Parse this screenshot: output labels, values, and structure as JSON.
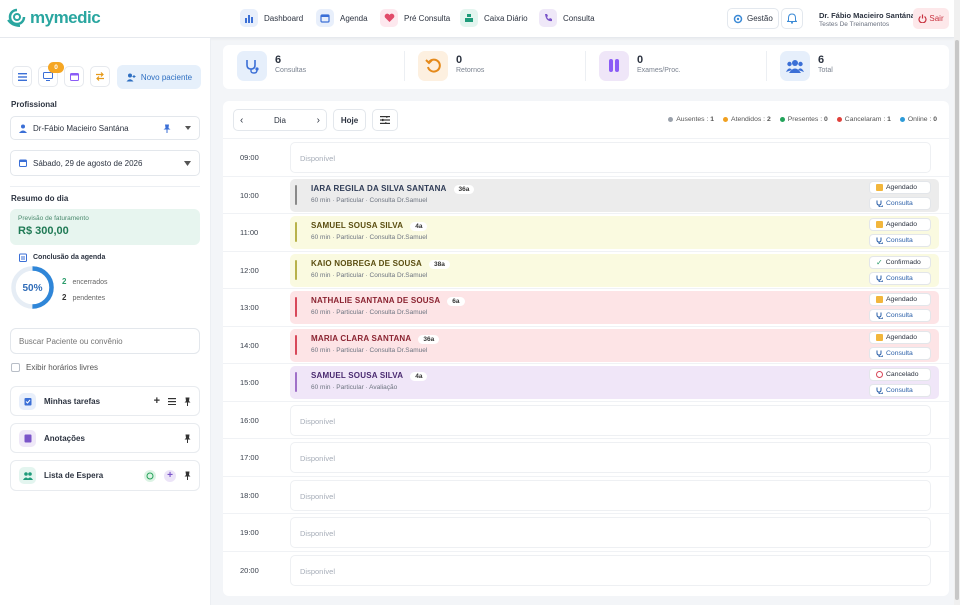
{
  "app": {
    "logo_text": "mymedic"
  },
  "nav": [
    {
      "label": "Dashboard",
      "icon": "bar-chart-icon",
      "color": "#3b6fd6"
    },
    {
      "label": "Agenda",
      "icon": "calendar-icon",
      "color": "#3b6fd6"
    },
    {
      "label": "Pré Consulta",
      "icon": "heart-pulse-icon",
      "color": "#e14b6a"
    },
    {
      "label": "Caixa Diário",
      "icon": "cash-register-icon",
      "color": "#1f9b7a"
    },
    {
      "label": "Consulta",
      "icon": "phone-icon",
      "color": "#7b55c9"
    }
  ],
  "header": {
    "gestao": "Gestão",
    "user_name": "Dr. Fábio Macieiro Santána",
    "user_sub": "Testes De Treinamentos",
    "logout": "Sair"
  },
  "sidebar": {
    "badge": "0",
    "novo_paciente": "Novo paciente",
    "profissional_label": "Profissional",
    "profissional": "Dr-Fábio Macieiro Santána",
    "date": "Sábado, 29 de agosto de 2026",
    "resumo_label": "Resumo do dia",
    "previsao_label": "Previsão de faturamento",
    "previsao_value": "R$ 300,00",
    "conclusao_label": "Conclusão da agenda",
    "conclusao_percent": "50%",
    "conclusao_fraction": 0.5,
    "encerrados_n": "2",
    "encerrados_l": "encerrados",
    "pendentes_n": "2",
    "pendentes_l": "pendentes",
    "search_placeholder": "Buscar Paciente ou convênio",
    "exibir_label": "Exibir horários livres",
    "tarefas": "Minhas tarefas",
    "anotacoes": "Anotações",
    "espera": "Lista de Espera"
  },
  "stats": [
    {
      "value": "6",
      "label": "Consultas",
      "icon": "stethoscope-icon"
    },
    {
      "value": "0",
      "label": "Retornos",
      "icon": "return-icon"
    },
    {
      "value": "0",
      "label": "Exames/Proc.",
      "icon": "test-tubes-icon"
    },
    {
      "value": "6",
      "label": "Total",
      "icon": "users-icon"
    }
  ],
  "schedule": {
    "view": "Dia",
    "today": "Hoje",
    "legend": [
      {
        "label": "Ausentes",
        "count": "1",
        "color": "#9aa1ab"
      },
      {
        "label": "Atendidos",
        "count": "2",
        "color": "#f0a020"
      },
      {
        "label": "Presentes",
        "count": "0",
        "color": "#22a35a"
      },
      {
        "label": "Cancelaram",
        "count": "1",
        "color": "#e0413b"
      },
      {
        "label": "Online",
        "count": "0",
        "color": "#2d9bd8"
      }
    ],
    "slots": [
      {
        "time": "09:00",
        "free": "Disponível"
      },
      {
        "time": "10:00",
        "name": "IARA REGILA DA SILVA SANTANA",
        "age": "36a",
        "detail": "60 min · Particular · Consulta Dr.Samuel",
        "status": "Agendado",
        "action": "Consulta",
        "bg": "#ececec",
        "bar": "#8a8a8a",
        "namecolor": "#2d3a55"
      },
      {
        "time": "11:00",
        "name": "SAMUEL SOUSA SILVA",
        "age": "4a",
        "detail": "60 min · Particular · Consulta Dr.Samuel",
        "status": "Agendado",
        "action": "Consulta",
        "bg": "#fafae0",
        "bar": "#b8b24a",
        "namecolor": "#5a4d10"
      },
      {
        "time": "12:00",
        "name": "KAIO NOBREGA DE SOUSA",
        "age": "38a",
        "detail": "60 min · Particular · Consulta Dr.Samuel",
        "status": "Confirmado",
        "action": "Consulta",
        "bg": "#fafae0",
        "bar": "#b8b24a",
        "namecolor": "#5a4d10"
      },
      {
        "time": "13:00",
        "name": "NATHALIE SANTANA DE SOUSA",
        "age": "6a",
        "detail": "60 min · Particular · Consulta Dr.Samuel",
        "status": "Agendado",
        "action": "Consulta",
        "bg": "#fde4e6",
        "bar": "#d8485a",
        "namecolor": "#8a2230"
      },
      {
        "time": "14:00",
        "name": "MARIA CLARA SANTANA",
        "age": "36a",
        "detail": "60 min · Particular · Consulta Dr.Samuel",
        "status": "Agendado",
        "action": "Consulta",
        "bg": "#fde4e6",
        "bar": "#d8485a",
        "namecolor": "#8a2230"
      },
      {
        "time": "15:00",
        "name": "SAMUEL SOUSA SILVA",
        "age": "4a",
        "detail": "60 min · Particular · Avaliação",
        "status": "Cancelado",
        "action": "Consulta",
        "bg": "#f0e6f8",
        "bar": "#a070c8",
        "namecolor": "#4a2a70"
      },
      {
        "time": "16:00",
        "free": "Disponível"
      },
      {
        "time": "17:00",
        "free": "Disponível"
      },
      {
        "time": "18:00",
        "free": "Disponível"
      },
      {
        "time": "19:00",
        "free": "Disponível"
      },
      {
        "time": "20:00",
        "free": "Disponível"
      }
    ]
  }
}
